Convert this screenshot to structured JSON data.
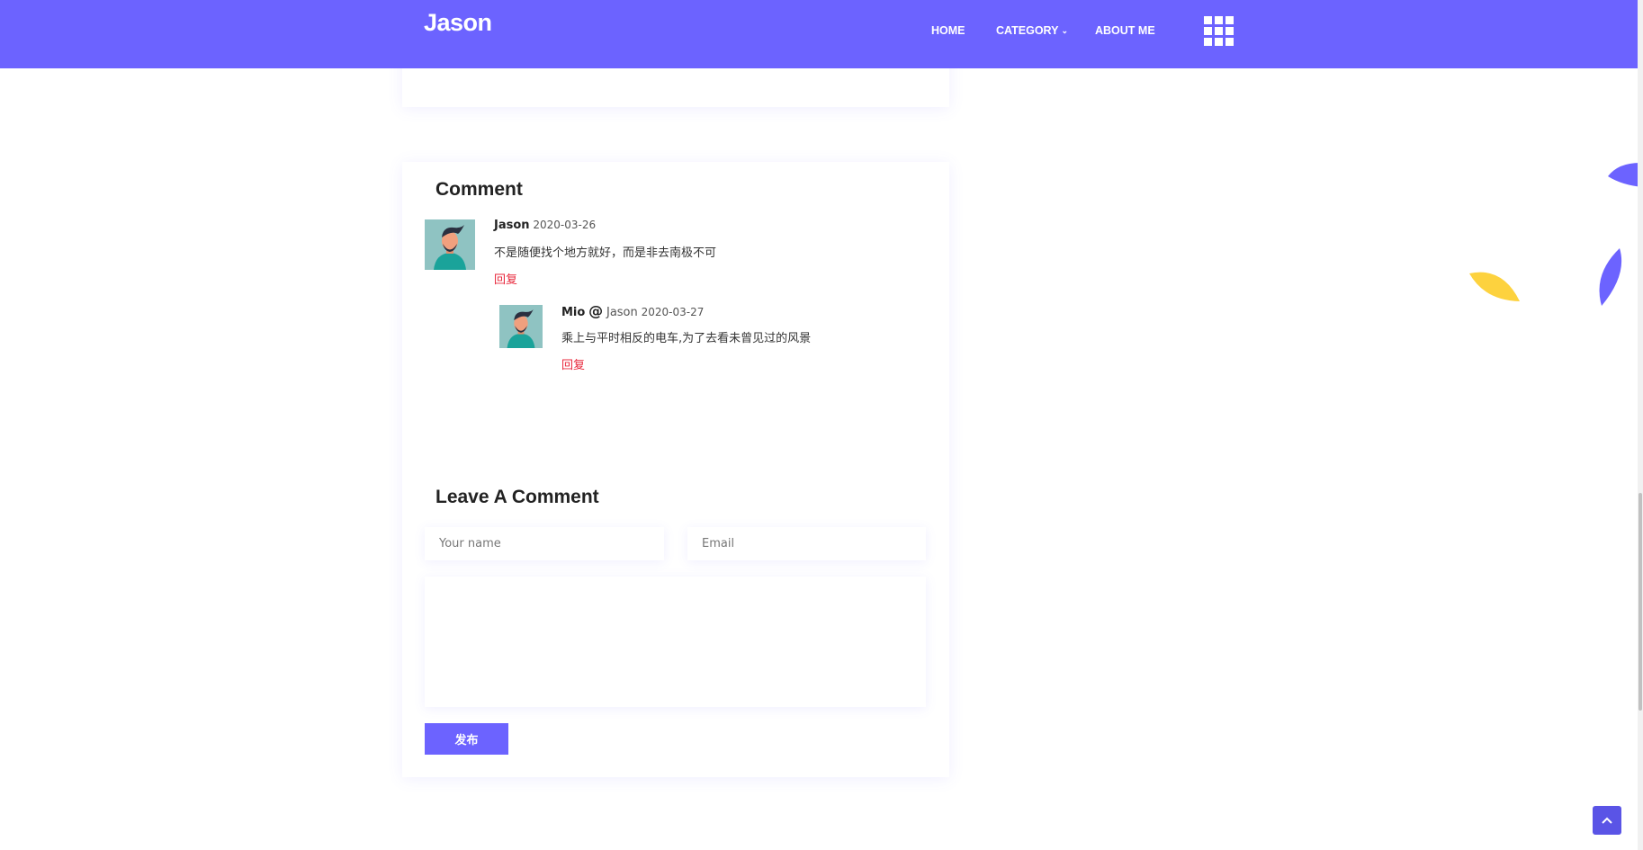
{
  "header": {
    "logo": "Jason",
    "nav": [
      {
        "label": "HOME"
      },
      {
        "label": "CATEGORY"
      },
      {
        "label": "ABOUT ME"
      }
    ]
  },
  "comments_section": {
    "title": "Comment",
    "comments": [
      {
        "author": "Jason",
        "date": "2020-03-26",
        "text": "不是随便找个地方就好，而是非去南极不可",
        "reply_label": "回复"
      },
      {
        "author": "Mio",
        "at_symbol": "@",
        "reply_to": "Jason",
        "date": "2020-03-27",
        "text": "乘上与平时相反的电车,为了去看未曾见过的风景",
        "reply_label": "回复"
      }
    ]
  },
  "leave_comment": {
    "title": "Leave A Comment",
    "name_placeholder": "Your name",
    "email_placeholder": "Email",
    "message_value": "",
    "submit_label": "发布"
  },
  "colors": {
    "primary": "#6c63ff",
    "reply": "#e8283c",
    "accent_yellow": "#fdd23e"
  },
  "icons": [
    "grid-menu-icon",
    "chevron-down-icon",
    "chevron-up-icon"
  ]
}
